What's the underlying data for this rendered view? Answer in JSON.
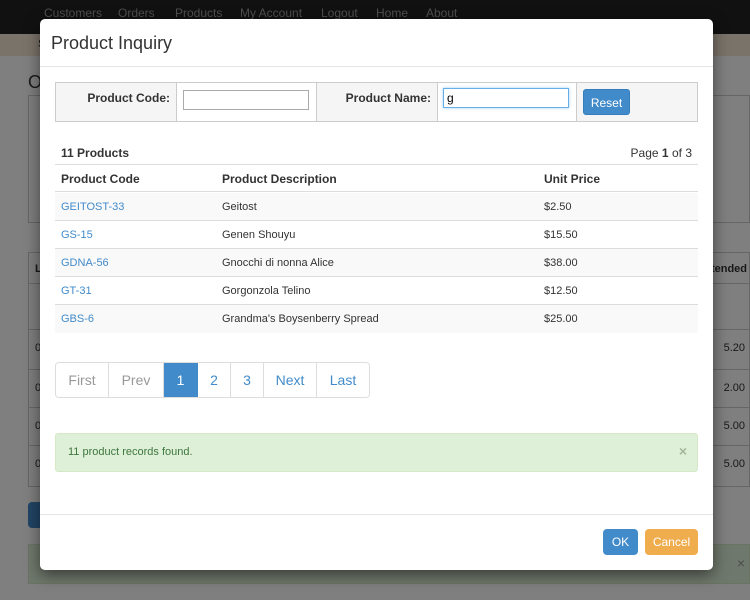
{
  "navbar": {
    "items": [
      "Customers",
      "Orders",
      "Products",
      "My Account",
      "Logout",
      "Home",
      "About"
    ]
  },
  "background": {
    "subbar_text": "S",
    "page_title": "O",
    "table_header_left": "L",
    "table_header_right": "tended",
    "rows_left": [
      "0",
      "0",
      "0",
      "0"
    ],
    "rows_right": [
      "5.20",
      "2.00",
      "5.00",
      "5.00"
    ],
    "alert_close": "×"
  },
  "modal": {
    "title": "Product Inquiry",
    "search": {
      "code_label": "Product Code:",
      "code_value": "",
      "name_label": "Product Name:",
      "name_value": "g",
      "reset_label": "Reset"
    },
    "summary": {
      "count": "11 Products",
      "page_prefix": "Page",
      "page_current": "1",
      "page_of": "of",
      "page_total": "3"
    },
    "table": {
      "headers": [
        "Product Code",
        "Product Description",
        "Unit Price"
      ],
      "rows": [
        {
          "code": "GEITOST-33",
          "description": "Geitost",
          "price": "$2.50"
        },
        {
          "code": "GS-15",
          "description": "Genen Shouyu",
          "price": "$15.50"
        },
        {
          "code": "GDNA-56",
          "description": "Gnocchi di nonna Alice",
          "price": "$38.00"
        },
        {
          "code": "GT-31",
          "description": "Gorgonzola Telino",
          "price": "$12.50"
        },
        {
          "code": "GBS-6",
          "description": "Grandma's Boysenberry Spread",
          "price": "$25.00"
        }
      ]
    },
    "pagination": {
      "first": "First",
      "prev": "Prev",
      "pages": [
        "1",
        "2",
        "3"
      ],
      "active_page": "1",
      "next": "Next",
      "last": "Last"
    },
    "alert": {
      "message": "11 product records found.",
      "close": "×"
    },
    "footer": {
      "ok_label": "OK",
      "cancel_label": "Cancel"
    }
  },
  "colors": {
    "primary": "#428bca",
    "warning": "#f0ad4e",
    "success_bg": "#dff0d8",
    "success_text": "#3c763d",
    "navbar_bg": "#222222"
  }
}
